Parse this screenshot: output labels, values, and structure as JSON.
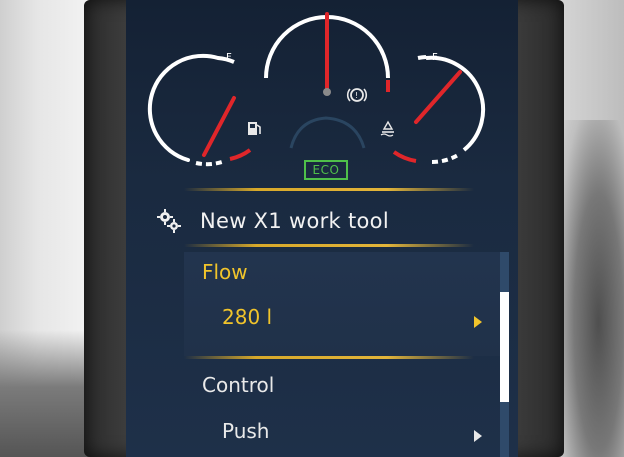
{
  "gauges": {
    "left_label": "F",
    "right_label": "F",
    "left_icon": "fuel-pump-icon",
    "center_icon": "brake-warning-icon",
    "right_icon": "hydraulic-oil-icon",
    "eco_badge": "ECO"
  },
  "menu": {
    "title": "New X1 work tool",
    "title_icon": "gears-icon",
    "items": [
      {
        "label": "Flow",
        "value": "280 l",
        "selected": true
      },
      {
        "label": "Control",
        "value": "Push",
        "selected": false
      }
    ]
  },
  "colors": {
    "accent_yellow": "#f1c42b",
    "eco_green": "#4fc04a",
    "needle_red": "#e0262a",
    "screen_bg": "#1a2a40"
  }
}
